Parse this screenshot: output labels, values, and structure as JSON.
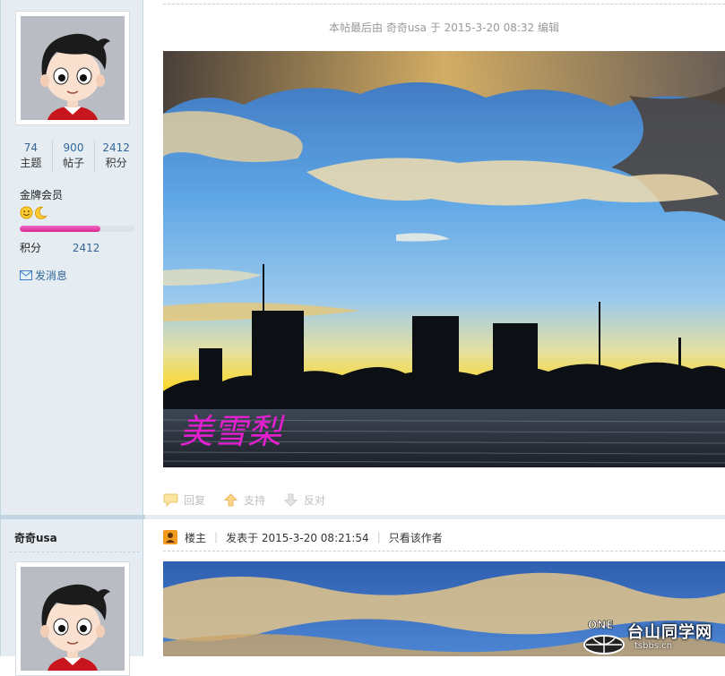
{
  "sidebar": {
    "stats": [
      {
        "value": "74",
        "label": "主题"
      },
      {
        "value": "900",
        "label": "帖子"
      },
      {
        "value": "2412",
        "label": "积分"
      }
    ],
    "rank_title": "金牌会员",
    "rank_progress_percent": 70,
    "points_label": "积分",
    "points_value": "2412",
    "send_message_label": "发消息",
    "author_name": "奇奇usa"
  },
  "post1": {
    "edit_note": "本帖最后由 奇奇usa 于 2015-3-20 08:32 编辑",
    "photo_signature": "美雪梨",
    "actions": {
      "reply": "回复",
      "support": "支持",
      "oppose": "反对"
    }
  },
  "post2": {
    "owner_label": "楼主",
    "posted_at": "发表于 2015-3-20 08:21:54",
    "only_author_label": "只看该作者"
  },
  "watermark": {
    "brand_badge": "ONE",
    "site_name": "台山同学网",
    "site_url": "tsbbs.cn"
  },
  "colors": {
    "sidebar_bg": "#e5edf2",
    "link_blue": "#336699",
    "rank_bar": "#e0409f",
    "signature_magenta": "#e41fd0"
  }
}
